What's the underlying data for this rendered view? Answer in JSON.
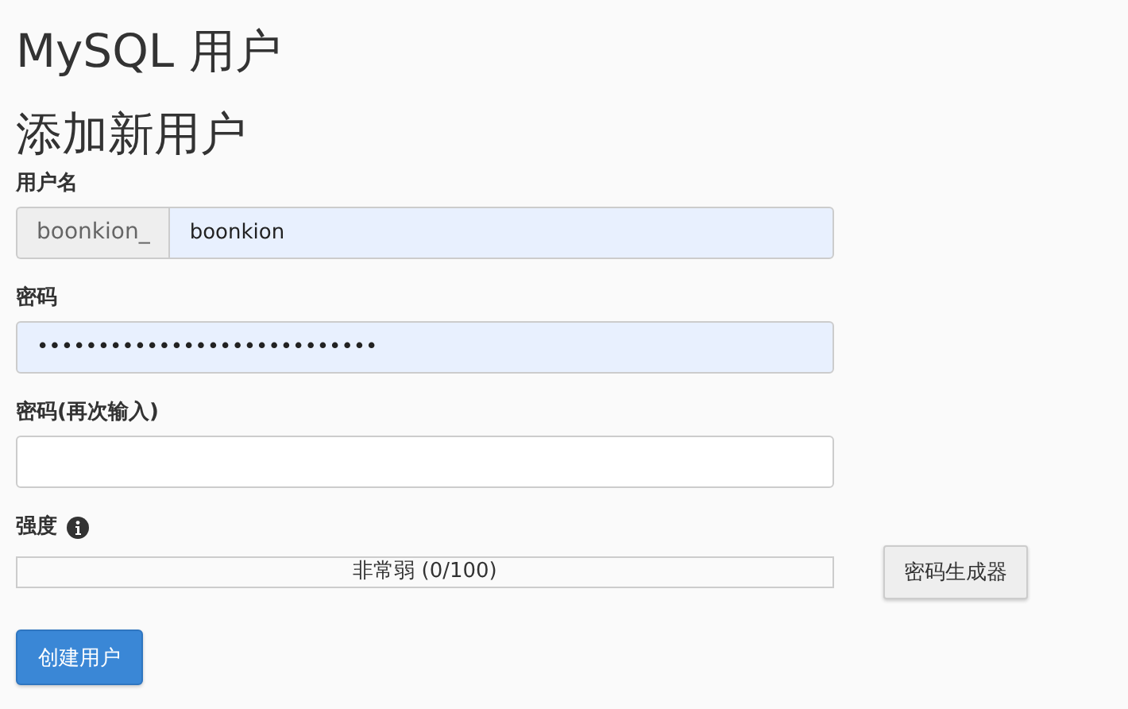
{
  "page_title": "MySQL 用户",
  "section_title": "添加新用户",
  "fields": [
    {
      "kind": "prefixed",
      "label": "用户名",
      "prefix": "boonkion_",
      "value": "boonkion",
      "autofilled": true
    },
    {
      "kind": "plain",
      "label": "密码",
      "value": "••••••••••••••••••••••••••••",
      "autofilled": true
    },
    {
      "kind": "plain",
      "label": "密码(再次输入)",
      "autofilled": false
    }
  ],
  "strength": {
    "label": "强度",
    "level": 0,
    "reading": "非常弱 (0/100)",
    "generator_button": "密码生成器"
  },
  "submit_button": "创建用户"
}
